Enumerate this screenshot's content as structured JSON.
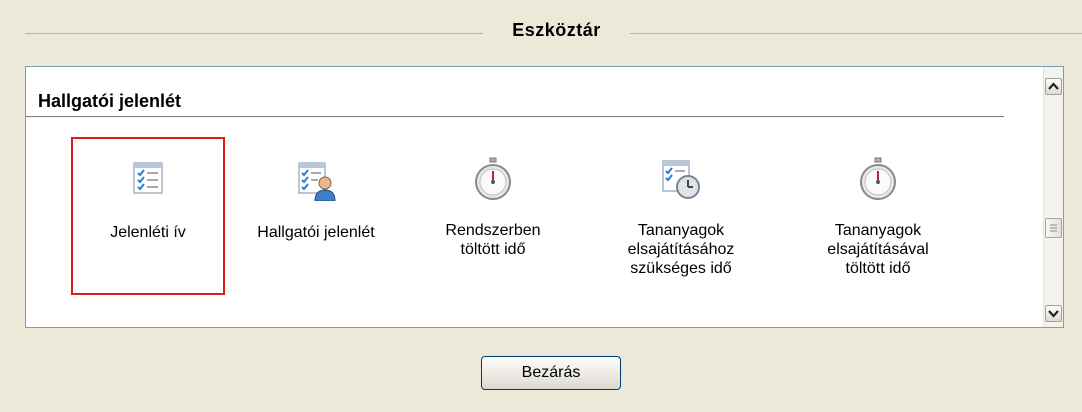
{
  "toolbar": {
    "title": "Eszköztár"
  },
  "section": {
    "title": "Hallgatói jelenlét"
  },
  "tools": [
    {
      "label": "Jelenléti ív",
      "icon": "checklist-icon"
    },
    {
      "label": "Hallgatói jelenlét",
      "icon": "checklist-user-icon"
    },
    {
      "label": "Rendszerben\ntöltött idő",
      "icon": "stopwatch-icon"
    },
    {
      "label": "Tananyagok\nelsajátításához\nszükséges idő",
      "icon": "checklist-clock-icon"
    },
    {
      "label": "Tananyagok\nelsajátításával\ntöltött idő",
      "icon": "stopwatch-icon"
    }
  ],
  "close_button": {
    "label": "Bezárás"
  }
}
